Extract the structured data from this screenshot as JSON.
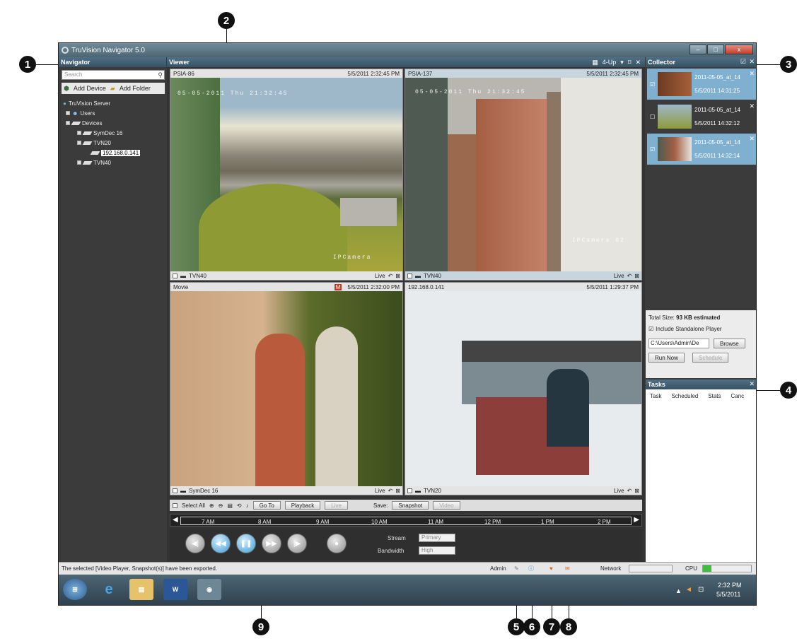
{
  "window": {
    "title": "TruVision Navigator 5.0",
    "min": "–",
    "max": "□",
    "close": "x"
  },
  "callouts": [
    "1",
    "2",
    "3",
    "4",
    "5",
    "6",
    "7",
    "8",
    "9"
  ],
  "navigator": {
    "title": "Navigator",
    "search_placeholder": "Search",
    "add_device": "Add Device",
    "add_folder": "Add Folder",
    "tree": {
      "server": "TruVision Server",
      "users": "Users",
      "devices": "Devices",
      "symdec": "SymDec 16",
      "tvn20": "TVN20",
      "ip": "192.168.0.141",
      "tvn40": "TVN40"
    }
  },
  "viewer": {
    "title": "Viewer",
    "layout_label": "4-Up",
    "cams": [
      {
        "name": "PSIA-86",
        "time": "5/5/2011 2:32:45 PM",
        "footer": "TVN40",
        "live": "Live",
        "osd": "05-05-2011 Thu 21:32:45",
        "osd2": "IPCamera"
      },
      {
        "name": "PSIA-137",
        "time": "5/5/2011 2:32:45 PM",
        "footer": "TVN40",
        "live": "Live",
        "osd": "05-05-2011 Thu 21:32:45",
        "osd2": "IPCamera 02"
      },
      {
        "name": "Movie",
        "badge": "M",
        "time": "5/5/2011 2:32:00 PM",
        "footer": "SymDec 16",
        "live": "Live"
      },
      {
        "name": "192.168.0.141",
        "time": "5/5/2011 1:29:37 PM",
        "footer": "TVN20",
        "live": "Live"
      }
    ],
    "controls": {
      "select_all": "Select All",
      "goto": "Go To",
      "playback": "Playback",
      "live": "Live",
      "save": "Save:",
      "snapshot": "Snapshot",
      "video": "Video"
    },
    "timeline": [
      "7 AM",
      "8 AM",
      "9 AM",
      "10 AM",
      "11 AM",
      "12 PM",
      "1 PM",
      "2 PM"
    ],
    "stream_label": "Stream",
    "stream_value": "Primary",
    "bandwidth_label": "Bandwidth",
    "bandwidth_value": "High"
  },
  "collector": {
    "title": "Collector",
    "items": [
      {
        "name": "2011-05-05_at_14",
        "time": "5/5/2011 14:31:25",
        "checked": true
      },
      {
        "name": "2011-05-05_at_14",
        "time": "5/5/2011 14:32:12",
        "checked": false
      },
      {
        "name": "2011-05-05_at_14",
        "time": "5/5/2011 14:32:14",
        "checked": true
      }
    ],
    "total_size_label": "Total Size:",
    "total_size_value": "93 KB estimated",
    "include_player": "Include Standalone Player",
    "path": "C:\\Users\\Admin\\De",
    "browse": "Browse",
    "run_now": "Run Now",
    "schedule": "Schedule"
  },
  "tasks": {
    "title": "Tasks",
    "cols": [
      "Task",
      "Scheduled",
      "Stats",
      "Canc"
    ]
  },
  "status": {
    "message": "The selected [Video Player, Snapshot(s)] have been exported.",
    "user": "Admin",
    "network": "Network",
    "cpu": "CPU"
  },
  "taskbar": {
    "time": "2:32 PM",
    "date": "5/5/2011"
  }
}
